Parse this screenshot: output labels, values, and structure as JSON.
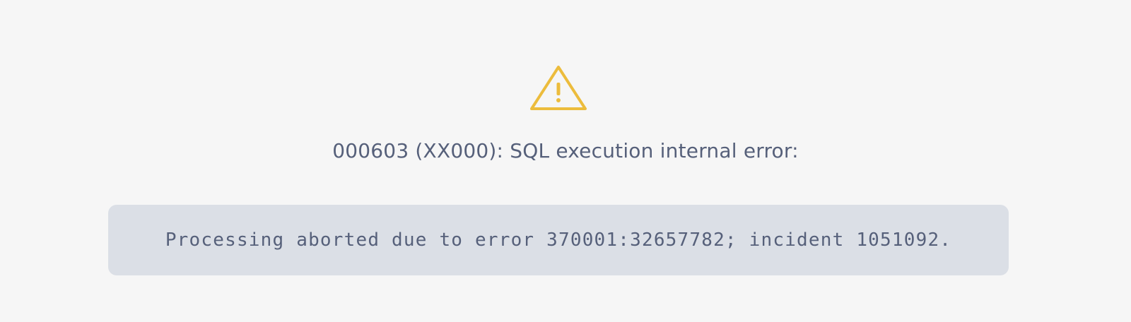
{
  "error": {
    "icon": "warning-triangle-icon",
    "icon_color": "#ecbc3c",
    "title": "000603 (XX000): SQL execution internal error:",
    "message": "Processing aborted due to error 370001:32657782; incident 1051092."
  },
  "colors": {
    "background": "#f6f6f6",
    "text": "#56607a",
    "message_box": "#dbdfe6"
  }
}
